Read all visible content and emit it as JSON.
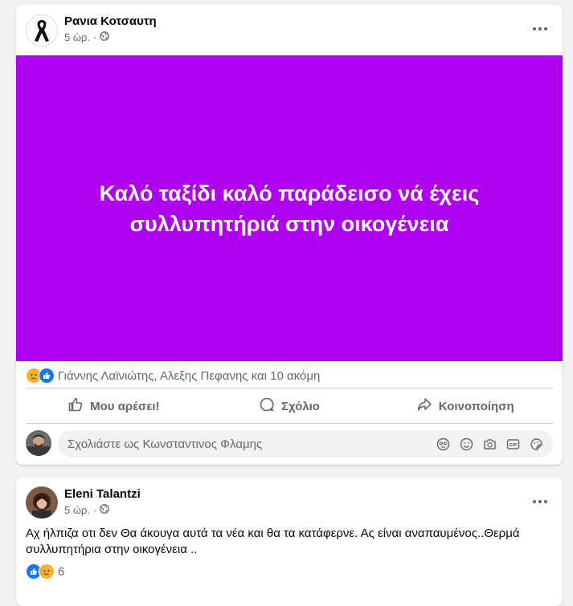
{
  "post1": {
    "author": "Ρανια Κοτσαυτη",
    "time": "5 ώρ.",
    "separator": "·",
    "image_text": "Καλό ταξίδι καλό παράδεισο νά έχεις συλλυπητήριά στην οικογένεια",
    "image_color": "#b000f2",
    "reactions_text": "Γιάννης Λαϊνιώτης, Αλεξης Πεφανης και 10 ακόμη",
    "actions": {
      "like": "Μου αρέσει!",
      "comment": "Σχόλιο",
      "share": "Κοινοποίηση"
    },
    "comment_placeholder": "Σχολιάστε ως Κωνσταντινος Φλαμης"
  },
  "post2": {
    "author": "Eleni Talantzi",
    "time": "5 ώρ.",
    "separator": "·",
    "body": "Αχ ήλπιζα οτι δεν Θα άκουγα αυτά  τα νέα και θα τα κατάφερνε. Ας είναι αναπαυμένος..Θερμά συλλυπητήρια στην οικογένεια ..",
    "reaction_count": "6"
  },
  "colors": {
    "accent": "#1877f2",
    "secondary_text": "#65676b",
    "background": "#f0f2f5"
  }
}
